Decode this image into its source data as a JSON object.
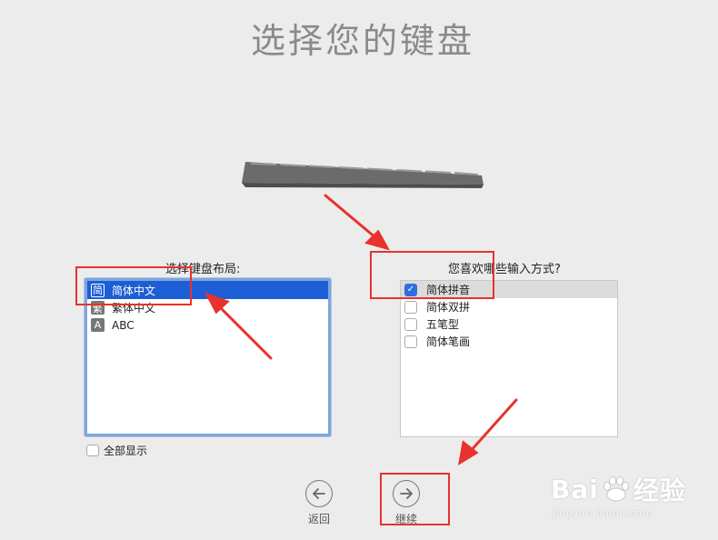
{
  "page": {
    "title": "选择您的键盘"
  },
  "layout_section": {
    "label": "选择键盘布局:",
    "items": [
      {
        "icon_char": "简",
        "label": "简体中文",
        "selected": true
      },
      {
        "icon_char": "繁",
        "label": "繁体中文",
        "selected": false
      },
      {
        "icon_char": "A",
        "label": "ABC",
        "selected": false
      }
    ],
    "show_all_label": "全部显示",
    "show_all_checked": false
  },
  "input_section": {
    "label": "您喜欢哪些输入方式?",
    "items": [
      {
        "label": "简体拼音",
        "checked": true
      },
      {
        "label": "简体双拼",
        "checked": false
      },
      {
        "label": "五笔型",
        "checked": false
      },
      {
        "label": "简体笔画",
        "checked": false
      }
    ]
  },
  "navigation": {
    "back_label": "返回",
    "next_label": "继续"
  },
  "watermark": {
    "brand_left": "Bai",
    "brand_right": "经验",
    "url": "jingyan.baidu.com"
  },
  "colors": {
    "selection_blue": "#1c5ed6",
    "annotation_red": "#e8322e",
    "title_gray": "#8a8a8a"
  },
  "icons": [
    "keyboard-image",
    "back-arrow-icon",
    "forward-arrow-icon",
    "checkmark-icon",
    "baidu-paw-icon"
  ]
}
